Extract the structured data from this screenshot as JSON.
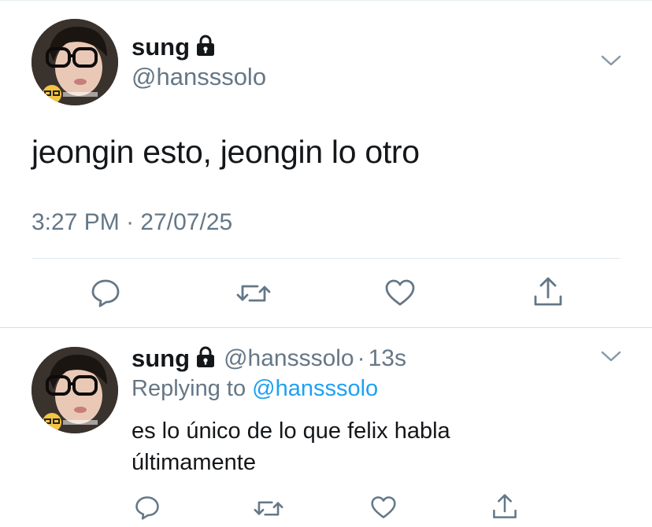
{
  "main_tweet": {
    "display_name": "sung",
    "handle": "@hansssolo",
    "text": "jeongin esto, jeongin lo otro",
    "time": "3:27 PM",
    "separator": "·",
    "date": "27/07/25",
    "actions": [
      "reply-icon",
      "retweet-icon",
      "like-icon",
      "share-icon"
    ],
    "protected_icon": "lock-icon",
    "menu_icon": "chevron-down-icon"
  },
  "reply_tweet": {
    "display_name": "sung",
    "handle": "@hansssolo",
    "dot": "·",
    "time": "13s",
    "replying_prefix": "Replying to",
    "replying_handle": "@hansssolo",
    "text": "es lo único de lo que felix habla últimamente",
    "actions": [
      "reply-icon",
      "retweet-icon",
      "like-icon",
      "share-icon"
    ]
  },
  "colors": {
    "text": "#14171a",
    "secondary": "#657786",
    "link": "#1da1f2",
    "divider": "#e1e8ed"
  }
}
